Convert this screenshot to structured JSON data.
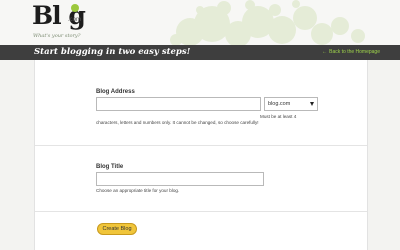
{
  "header": {
    "logo_text": "Bl g",
    "logo_domain": ".com",
    "tagline": "What's your story?"
  },
  "banner": {
    "title": "Start blogging in two easy steps!",
    "back_link": "Back to the Homepage",
    "back_arrow": "←"
  },
  "form": {
    "blog_address": {
      "label": "Blog Address",
      "value": "",
      "domain_select": "blog.com",
      "hint_right": "Must be at least 4",
      "hint_below": "characters, letters and numbers only. It cannot be changed, so choose carefully!"
    },
    "blog_title": {
      "label": "Blog Title",
      "value": "",
      "hint": "Choose an appropriate title for your blog."
    },
    "create_button": "Create Blog"
  },
  "colors": {
    "accent_green": "#9cc83c",
    "banner_bg": "#3e3e3e",
    "button_yellow": "#f0c53a"
  }
}
